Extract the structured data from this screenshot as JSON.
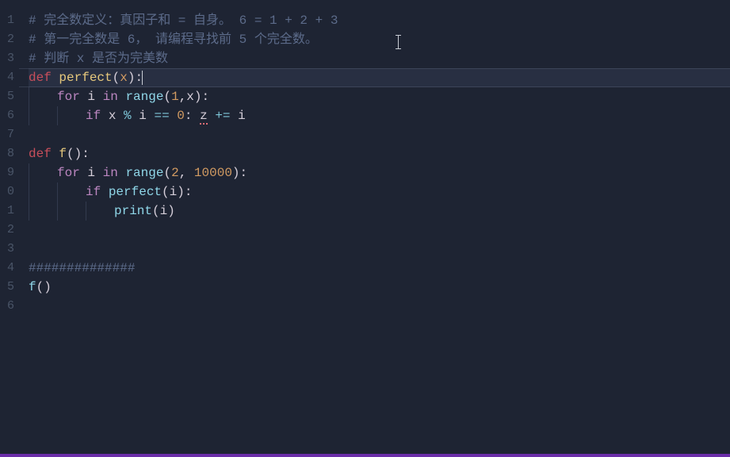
{
  "gutter": [
    "1",
    "2",
    "3",
    "4",
    "5",
    "6",
    "7",
    "8",
    "9",
    "0",
    "1",
    "2",
    "3",
    "4",
    "5",
    "6"
  ],
  "code": {
    "l1": "# 完全数定义：真因子和 = 自身。 6 = 1 + 2 + 3",
    "l2": "# 第一完全数是 6， 请编程寻找前 5 个完全数。",
    "l3": "# 判断 x 是否为完美数",
    "l4_def": "def",
    "l4_fn": "perfect",
    "l4_open": "(",
    "l4_param": "x",
    "l4_close": ")",
    "l4_colon": ":",
    "l5_for": "for",
    "l5_i": "i",
    "l5_in": "in",
    "l5_range": "range",
    "l5_open": "(",
    "l5_a": "1",
    "l5_comma": ",",
    "l5_b": "x",
    "l5_close": ")",
    "l5_colon": ":",
    "l6_if": "if",
    "l6_x": "x",
    "l6_mod": "%",
    "l6_i": "i",
    "l6_eq": "==",
    "l6_zero": "0",
    "l6_colon": ":",
    "l6_z": "z",
    "l6_pluseq": "+=",
    "l6_i2": "i",
    "l8_def": "def",
    "l8_fn": "f",
    "l8_open": "(",
    "l8_close": ")",
    "l8_colon": ":",
    "l9_for": "for",
    "l9_i": "i",
    "l9_in": "in",
    "l9_range": "range",
    "l9_open": "(",
    "l9_a": "2",
    "l9_comma": ",",
    "l9_b": "10000",
    "l9_close": ")",
    "l9_colon": ":",
    "l10_if": "if",
    "l10_perfect": "perfect",
    "l10_open": "(",
    "l10_i": "i",
    "l10_close": ")",
    "l10_colon": ":",
    "l11_print": "print",
    "l11_open": "(",
    "l11_i": "i",
    "l11_close": ")",
    "l14": "##############",
    "l15_f": "f",
    "l15_open": "(",
    "l15_close": ")"
  }
}
